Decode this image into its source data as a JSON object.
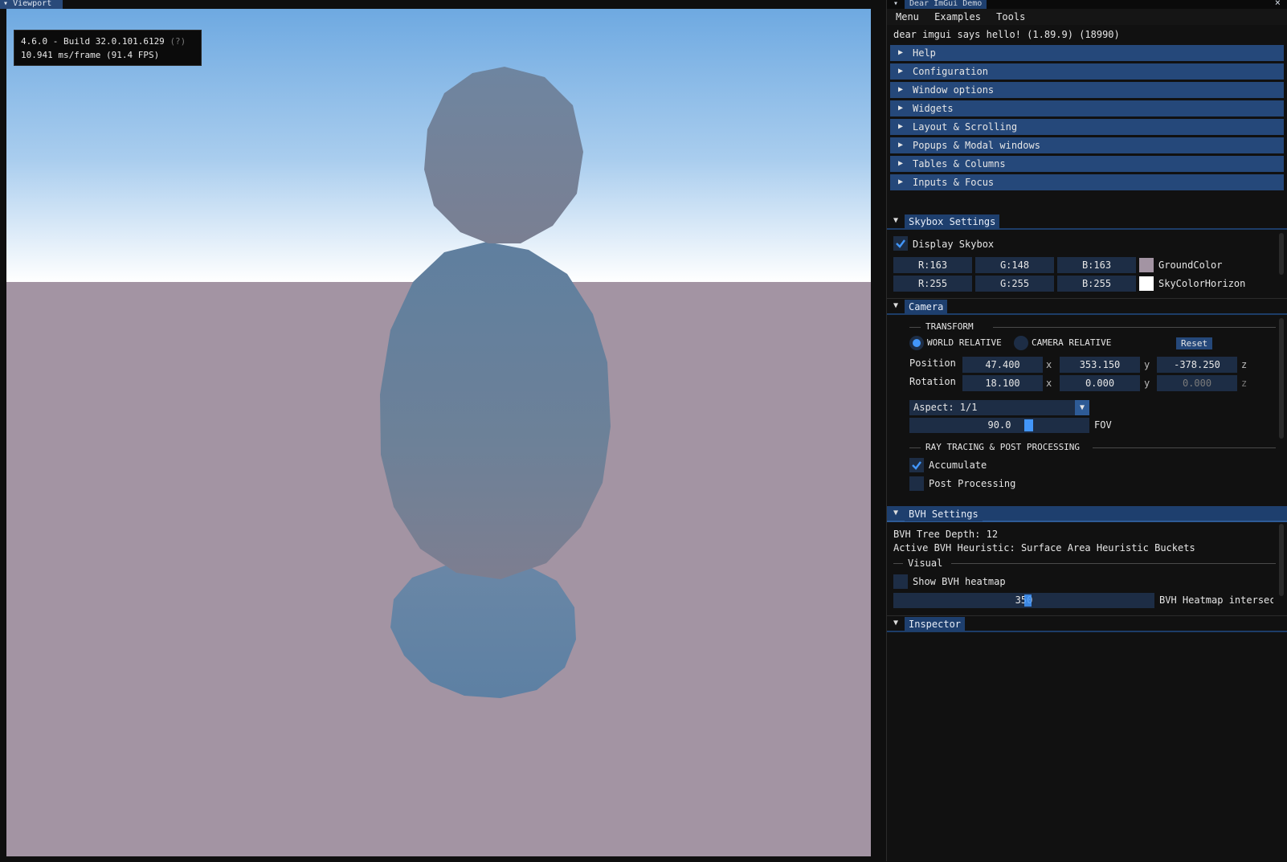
{
  "viewport": {
    "tab_label": "Viewport",
    "overlay": {
      "build_line": "4.6.0 - Build 32.0.101.6129",
      "build_help": "(?)",
      "fps_line": "10.941 ms/frame (91.4 FPS)"
    },
    "colors": {
      "sky_top": "#6aa8e0",
      "sky_horizon": "#ffffff",
      "ground": "#a394a3",
      "object": "#6e86a0"
    }
  },
  "demo": {
    "window_title": "Dear ImGui Demo",
    "close_glyph": "×",
    "menu": [
      "Menu",
      "Examples",
      "Tools"
    ],
    "hello_text": "dear imgui says hello! (1.89.9) (18990)",
    "sections": [
      "Help",
      "Configuration",
      "Window options",
      "Widgets",
      "Layout & Scrolling",
      "Popups & Modal windows",
      "Tables & Columns",
      "Inputs & Focus"
    ]
  },
  "skybox": {
    "tab_label": "Skybox Settings",
    "display_label": "Display Skybox",
    "display_checked": true,
    "rows": [
      {
        "r": "R:163",
        "g": "G:148",
        "b": "B:163",
        "label": "GroundColor",
        "swatch": "#a394a3"
      },
      {
        "r": "R:255",
        "g": "G:255",
        "b": "B:255",
        "label": "SkyColorHorizon",
        "swatch": "#ffffff"
      }
    ]
  },
  "camera": {
    "tab_label": "Camera",
    "transform_header": "TRANSFORM",
    "world_relative": "WORLD RELATIVE",
    "camera_relative": "CAMERA RELATIVE",
    "reset_label": "Reset",
    "position_label": "Position",
    "position": [
      "47.400",
      "353.150",
      "-378.250"
    ],
    "rotation_label": "Rotation",
    "rotation": [
      "18.100",
      "0.000",
      "0.000"
    ],
    "axes": [
      "x",
      "y",
      "z"
    ],
    "aspect_label": "Aspect: 1/1",
    "fov_value": "90.0",
    "fov_label": "FOV",
    "raytracing_header": "RAY TRACING & POST PROCESSING",
    "accumulate_label": "Accumulate",
    "accumulate_checked": true,
    "post_processing_label": "Post Processing",
    "post_processing_checked": false
  },
  "bvh": {
    "tab_label": "BVH Settings",
    "depth_text": "BVH Tree Depth: 12",
    "heuristic_text": "Active BVH Heuristic: Surface Area Heuristic Buckets",
    "visual_header": "Visual",
    "heatmap_label": "Show BVH heatmap",
    "heatmap_checked": false,
    "slider_value": "350",
    "slider_label": "BVH Heatmap intersect"
  },
  "inspector": {
    "tab_label": "Inspector"
  },
  "accent": "#4296fa"
}
